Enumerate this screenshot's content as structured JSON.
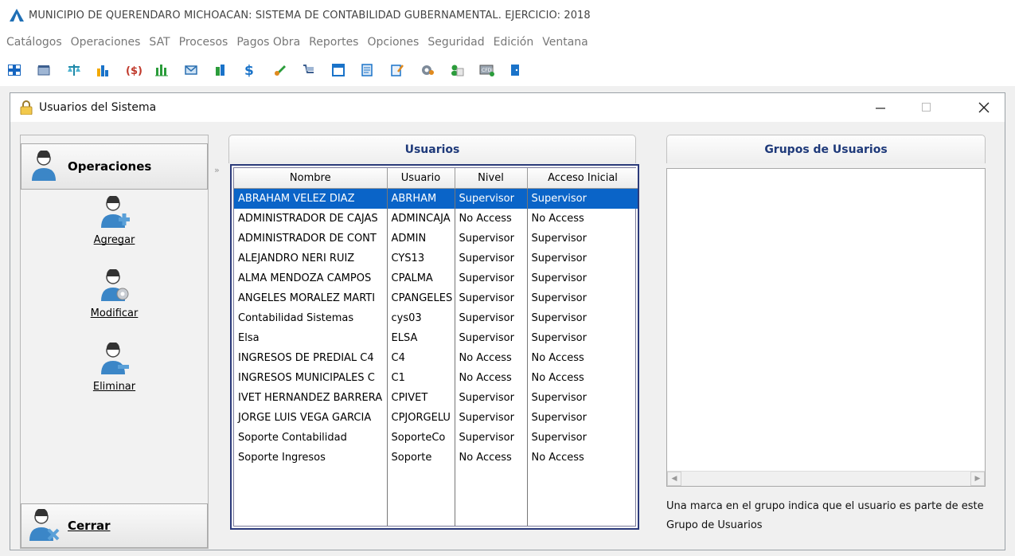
{
  "app": {
    "title": "MUNICIPIO DE QUERENDARO MICHOACAN: SISTEMA DE CONTABILIDAD GUBERNAMENTAL. EJERCICIO: 2018"
  },
  "menu": [
    "Catálogos",
    "Operaciones",
    "SAT",
    "Procesos",
    "Pagos Obra",
    "Reportes",
    "Opciones",
    "Seguridad",
    "Edición",
    "Ventana"
  ],
  "toolbar": {
    "icons": [
      "grid-icon",
      "calendar-icon",
      "balance-scale-icon",
      "bar-chart-icon",
      "money-icon",
      "columns-chart-icon",
      "mail-icon",
      "building-icon",
      "dollar-icon",
      "pencil-icon",
      "cart-icon",
      "window-icon",
      "document-icon",
      "edit-doc-icon",
      "config-icon",
      "users-icon",
      "cfdi-icon",
      "exit-door-icon"
    ]
  },
  "window": {
    "title": "Usuarios del Sistema"
  },
  "sidebar": {
    "header": "Operaciones",
    "actions": [
      {
        "label": "Agregar"
      },
      {
        "label": "Modificar"
      },
      {
        "label": "Eliminar"
      }
    ],
    "close": "Cerrar"
  },
  "users_panel": {
    "title": "Usuarios",
    "columns": [
      "Nombre",
      "Usuario",
      "Nivel",
      "Acceso Inicial"
    ],
    "rows": [
      [
        "ABRAHAM VELEZ DIAZ",
        "ABRHAM",
        "Supervisor",
        "Supervisor"
      ],
      [
        "ADMINISTRADOR DE CAJAS",
        "ADMINCAJA",
        "No Access",
        "No Access"
      ],
      [
        "ADMINISTRADOR DE CONT",
        "ADMIN",
        "Supervisor",
        "Supervisor"
      ],
      [
        "ALEJANDRO NERI RUIZ",
        "CYS13",
        "Supervisor",
        "Supervisor"
      ],
      [
        "ALMA MENDOZA CAMPOS",
        "CPALMA",
        "Supervisor",
        "Supervisor"
      ],
      [
        "ANGELES MORALEZ MARTI",
        "CPANGELES",
        "Supervisor",
        "Supervisor"
      ],
      [
        "Contabilidad Sistemas",
        "cys03",
        "Supervisor",
        "Supervisor"
      ],
      [
        "Elsa",
        "ELSA",
        "Supervisor",
        "Supervisor"
      ],
      [
        "INGRESOS DE PREDIAL C4",
        "C4",
        "No Access",
        "No Access"
      ],
      [
        "INGRESOS MUNICIPALES C",
        "C1",
        "No Access",
        "No Access"
      ],
      [
        "IVET HERNANDEZ BARRERA",
        "CPIVET",
        "Supervisor",
        "Supervisor"
      ],
      [
        "JORGE LUIS VEGA GARCIA",
        "CPJORGELU",
        "Supervisor",
        "Supervisor"
      ],
      [
        "Soporte Contabilidad",
        "SoporteCo",
        "Supervisor",
        "Supervisor"
      ],
      [
        "Soporte Ingresos",
        "Soporte",
        "No Access",
        "No Access"
      ]
    ],
    "selected_row": 0
  },
  "groups_panel": {
    "title": "Grupos de Usuarios",
    "note": "Una marca en el grupo indica que el usuario es parte de este Grupo de Usuarios"
  },
  "colors": {
    "selection": "#0a64c8",
    "panel_title": "#1f3a7a",
    "grid_border": "#2b3a7a"
  }
}
